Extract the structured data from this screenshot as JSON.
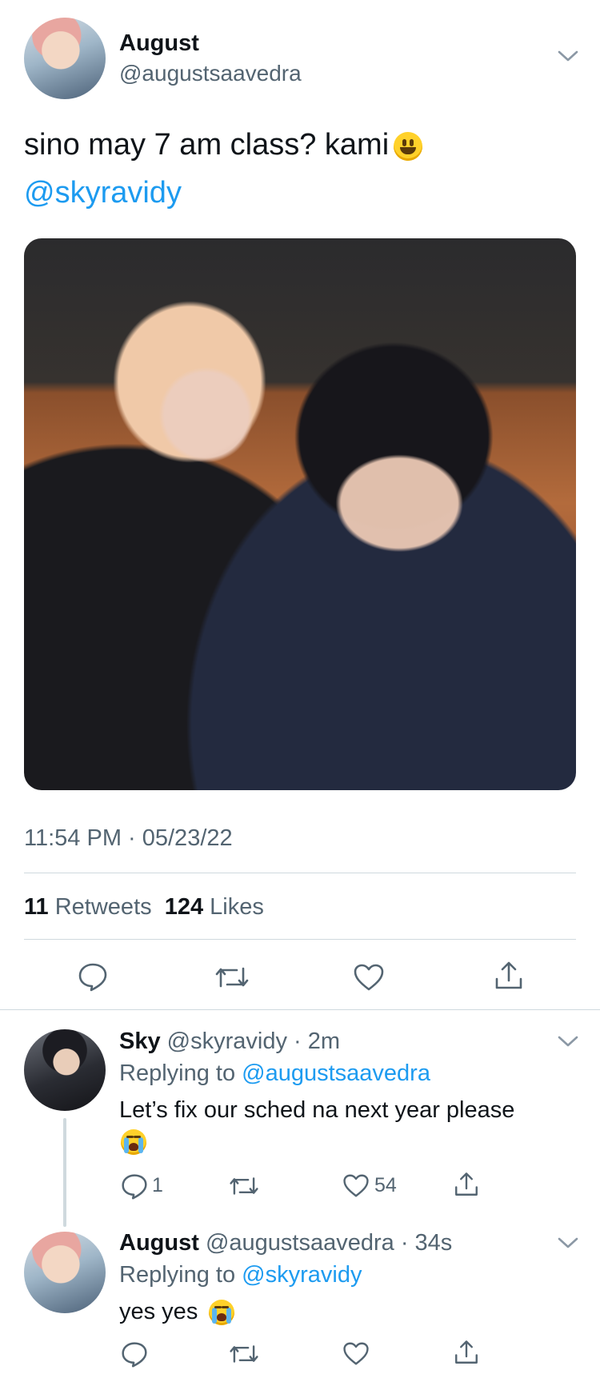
{
  "tweet": {
    "author_name": "August",
    "author_handle": "@augustsaavedra",
    "text": "sino may 7 am class? kami",
    "emoji": "grinning-face",
    "mention": "@skyravidy",
    "timestamp": "11:54 PM · 05/23/22",
    "retweets_count": "11",
    "retweets_label": "Retweets",
    "likes_count": "124",
    "likes_label": "Likes"
  },
  "replies": [
    {
      "author_name": "Sky",
      "author_handle": "@skyravidy",
      "time": "· 2m",
      "replying_label": "Replying to",
      "replying_to": "@augustsaavedra",
      "text": "Let’s fix our sched na next year please",
      "emoji": "loudly-crying-face",
      "reply_count": "1",
      "like_count": "54"
    },
    {
      "author_name": "August",
      "author_handle": "@augustsaavedra",
      "time": "· 34s",
      "replying_label": "Replying to",
      "replying_to": "@skyravidy",
      "text": "yes yes",
      "emoji": "loudly-crying-face",
      "reply_count": "",
      "like_count": ""
    }
  ],
  "colors": {
    "link": "#1d9bf0",
    "muted": "#536471",
    "divider": "#cfd9de",
    "text": "#0f1419"
  },
  "icons": [
    "chevron-down-icon",
    "reply-icon",
    "retweet-icon",
    "like-icon",
    "share-icon"
  ]
}
